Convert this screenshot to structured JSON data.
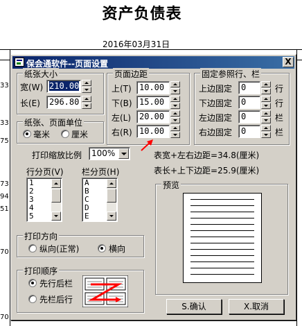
{
  "report": {
    "title": "资产负债表",
    "date": "2016年03月31日",
    "row_numbers": [
      "33",
      "33",
      "75",
      "73",
      "94",
      "51",
      "70",
      "70"
    ]
  },
  "dialog": {
    "title": "保会通软件--页面设置",
    "close_label": "X",
    "paper_size": {
      "legend": "纸张大小",
      "width_label": "宽(W)",
      "width_value": "210.00",
      "length_label": "长(E)",
      "length_value": "296.80"
    },
    "units": {
      "legend": "纸张、页面单位",
      "mm_label": "毫米",
      "cm_label": "厘米",
      "selected": "毫米"
    },
    "margins": {
      "legend": "页面边距",
      "top_label": "上(T)",
      "top_value": "10.00",
      "bottom_label": "下(B)",
      "bottom_value": "15.00",
      "left_label": "左(L)",
      "left_value": "20.00",
      "right_label": "右(R)",
      "right_value": "10.00"
    },
    "fixed": {
      "legend": "固定参照行、栏",
      "top_label": "上边固定",
      "top_value": "0",
      "top_unit": "行",
      "bottom_label": "下边固定",
      "bottom_value": "0",
      "bottom_unit": "行",
      "left_label": "左边固定",
      "left_value": "0",
      "left_unit": "栏",
      "right_label": "右边固定",
      "right_value": "0",
      "right_unit": "栏"
    },
    "scale": {
      "label": "打印缩放比例",
      "value": "100%"
    },
    "info": {
      "width_sum": "表宽+左右边距=34.8(厘米)",
      "length_sum": "表长+上下边距=25.9(厘米)"
    },
    "row_paging": {
      "label": "行分页(V)",
      "items": [
        "1",
        "2",
        "3",
        "4",
        "5"
      ]
    },
    "col_paging": {
      "label": "栏分页(H)",
      "items": [
        "A",
        "B",
        "C",
        "D",
        "E"
      ]
    },
    "preview": {
      "legend": "预览"
    },
    "orientation": {
      "legend": "打印方向",
      "portrait_label": "纵向(正常)",
      "landscape_label": "横向",
      "selected": "横向"
    },
    "order": {
      "legend": "打印顺序",
      "row_first_label": "先行后栏",
      "col_first_label": "先栏后行",
      "selected": "先行后栏"
    },
    "ok_label": "S.确认",
    "cancel_label": "X.取消"
  },
  "colors": {
    "titlebar_start": "#0a246a",
    "titlebar_end": "#3a6ea5",
    "dialog_face": "#d4d0c8",
    "annotation_arrow": "#ff0000"
  }
}
